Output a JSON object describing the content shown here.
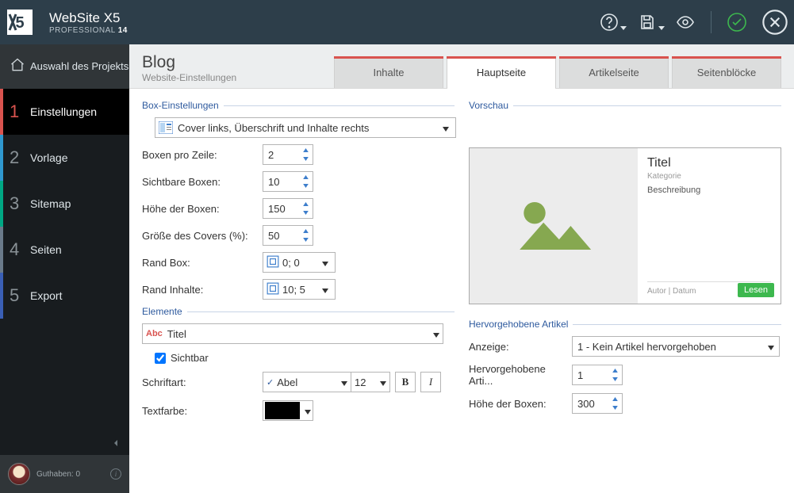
{
  "app": {
    "name": "WebSite X5",
    "editionLine": "PROFESSIONAL",
    "version": "14"
  },
  "sidebar": {
    "home": "Auswahl des Projekts",
    "items": [
      {
        "num": "1",
        "label": "Einstellungen"
      },
      {
        "num": "2",
        "label": "Vorlage"
      },
      {
        "num": "3",
        "label": "Sitemap"
      },
      {
        "num": "4",
        "label": "Seiten"
      },
      {
        "num": "5",
        "label": "Export"
      }
    ],
    "creditLabel": "Guthaben: 0"
  },
  "page": {
    "title": "Blog",
    "subtitle": "Website-Einstellungen",
    "tabs": [
      "Inhalte",
      "Hauptseite",
      "Artikelseite",
      "Seitenblöcke"
    ],
    "activeTab": 1
  },
  "left": {
    "groupBox": "Box-Einstellungen",
    "layoutCombo": "Cover links, Überschrift und Inhalte rechts",
    "rows": {
      "boxesPerRow": {
        "label": "Boxen pro Zeile:",
        "value": "2"
      },
      "visibleBoxes": {
        "label": "Sichtbare Boxen:",
        "value": "10"
      },
      "boxHeight": {
        "label": "Höhe der Boxen:",
        "value": "150"
      },
      "coverSize": {
        "label": "Größe des Covers (%):",
        "value": "50"
      },
      "marginBox": {
        "label": "Rand Box:",
        "value": "0; 0"
      },
      "marginContent": {
        "label": "Rand Inhalte:",
        "value": "10; 5"
      }
    },
    "groupElements": "Elemente",
    "elementCombo": "Titel",
    "visibleCheck": "Sichtbar",
    "fontLabel": "Schriftart:",
    "fontName": "Abel",
    "fontSize": "12",
    "colorLabel": "Textfarbe:"
  },
  "right": {
    "groupPreview": "Vorschau",
    "preview": {
      "title": "Titel",
      "category": "Kategorie",
      "description": "Beschreibung",
      "author": "Autor | Datum",
      "button": "Lesen"
    },
    "groupFeatured": "Hervorgehobene Artikel",
    "display": {
      "label": "Anzeige:",
      "value": "1 - Kein Artikel hervorgehoben"
    },
    "featuredCount": {
      "label": "Hervorgehobene Arti...",
      "value": "1"
    },
    "featuredHeight": {
      "label": "Höhe der Boxen:",
      "value": "300"
    }
  }
}
